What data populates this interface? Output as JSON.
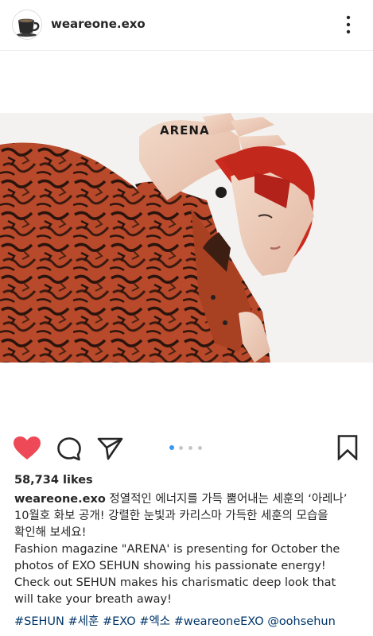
{
  "post": {
    "username": "weareone.exo",
    "image_text": "ARENA",
    "likes": "58,734 likes",
    "caption_username": "weareone.exo",
    "caption_text_1": "정열적인 에너지를 가득 뿜어내는 세훈의 ‘아레나’",
    "caption_text_2": "10월호 화보 공개! 강렬한 눈빛과 카리스마 가득한 세훈의 모습을",
    "caption_text_3": "확인해 보세요!",
    "caption_text_4": "Fashion magazine \"ARENA' is presenting for October the",
    "caption_text_5": "photos of EXO SEHUN showing his passionate energy!",
    "caption_text_6": "Check out SEHUN makes his charismatic deep look that",
    "caption_text_7": "will take your breath away!",
    "hashtags": [
      "#SEHUN",
      "#세훈",
      "#EXO",
      "#엑소",
      "#weareoneEXO",
      "@oohsehun"
    ]
  },
  "carousel": {
    "count": 4,
    "active_index": 0
  },
  "colors": {
    "like_red": "#ed4956",
    "link_blue": "#003569",
    "active_dot": "#3897f0"
  },
  "icons": [
    "avatar-cup-icon",
    "more-options-icon",
    "heart-icon",
    "comment-icon",
    "share-icon",
    "bookmark-icon"
  ]
}
